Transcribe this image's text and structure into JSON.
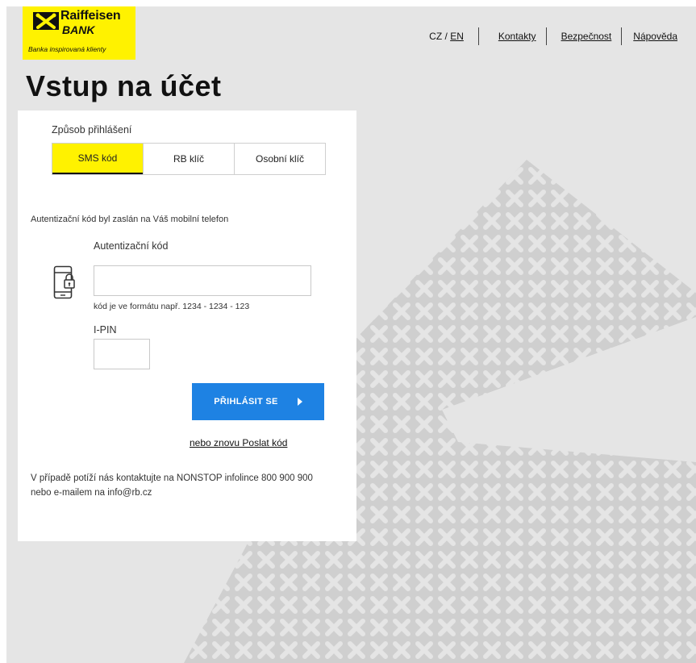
{
  "brand": {
    "line1": "Raiffeisen",
    "line2": "BANK",
    "tagline": "Banka inspirovaná klienty",
    "yellow": "#fff200"
  },
  "top_nav": {
    "lang_cz": "CZ",
    "lang_sep": "/",
    "lang_en": "EN",
    "links": [
      "Kontakty",
      "Bezpečnost",
      "Nápověda"
    ]
  },
  "page_title": "Vstup na účet",
  "login": {
    "method_label": "Způsob přihlášení",
    "tabs": [
      {
        "label": "SMS kód",
        "active": true
      },
      {
        "label": "RB klíč",
        "active": false
      },
      {
        "label": "Osobní klíč",
        "active": false
      }
    ],
    "sent_info": "Autentizační kód byl zaslán na Váš mobilní telefon",
    "auth_code_label": "Autentizační kód",
    "auth_code_value": "",
    "auth_code_hint": "kód je ve formátu např. 1234 - 1234 - 123",
    "ipin_label": "I-PIN",
    "ipin_value": "",
    "submit_label": "PŘIHLÁSIT SE",
    "resend_label": "nebo znovu Poslat kód",
    "contact_text": "V případě potíží nás kontaktujte na NONSTOP infolince 800 900 900 nebo e-mailem na info@rb.cz",
    "button_color": "#1e82e3"
  },
  "icons": {
    "logo": "raiffeisen-crossed-horses-icon",
    "phone": "phone-lock-icon",
    "submit": "arrow-right-icon"
  }
}
